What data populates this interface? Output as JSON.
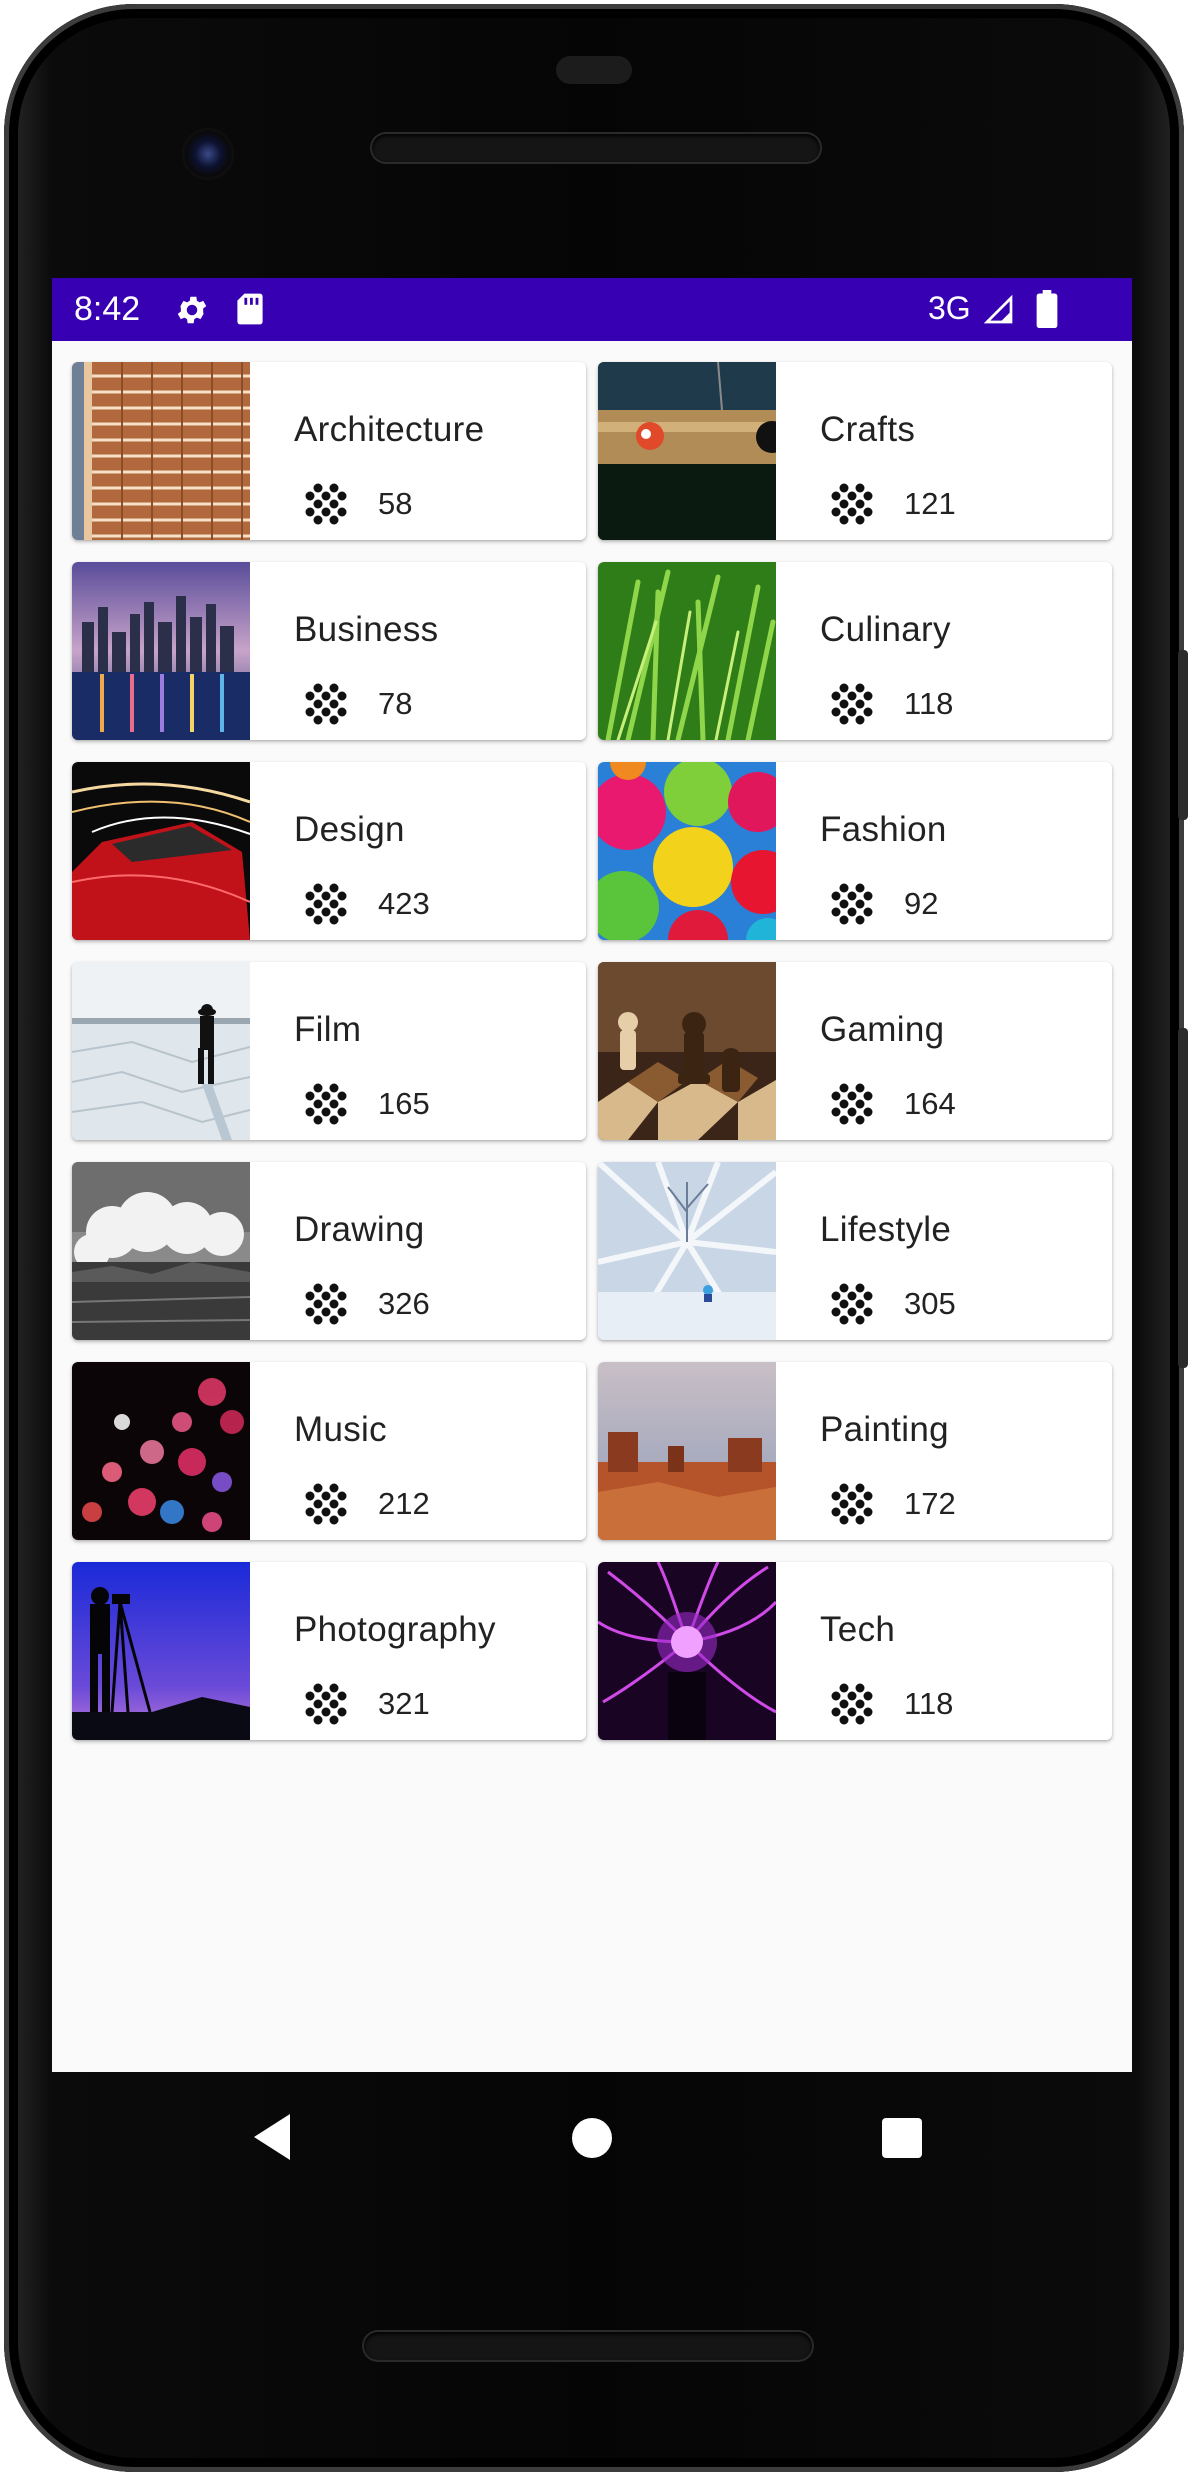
{
  "status_bar": {
    "time": "8:42",
    "network": "3G",
    "icons": [
      "gear-icon",
      "sd-card-icon",
      "signal-icon",
      "battery-icon"
    ],
    "background_color": "#3700b3"
  },
  "categories": [
    {
      "name": "Architecture",
      "count": "58"
    },
    {
      "name": "Crafts",
      "count": "121"
    },
    {
      "name": "Business",
      "count": "78"
    },
    {
      "name": "Culinary",
      "count": "118"
    },
    {
      "name": "Design",
      "count": "423"
    },
    {
      "name": "Fashion",
      "count": "92"
    },
    {
      "name": "Film",
      "count": "165"
    },
    {
      "name": "Gaming",
      "count": "164"
    },
    {
      "name": "Drawing",
      "count": "326"
    },
    {
      "name": "Lifestyle",
      "count": "305"
    },
    {
      "name": "Music",
      "count": "212"
    },
    {
      "name": "Painting",
      "count": "172"
    },
    {
      "name": "Photography",
      "count": "321"
    },
    {
      "name": "Tech",
      "count": "118"
    }
  ],
  "nav_bar": {
    "icons": [
      "back-icon",
      "home-icon",
      "recent-apps-icon"
    ]
  }
}
